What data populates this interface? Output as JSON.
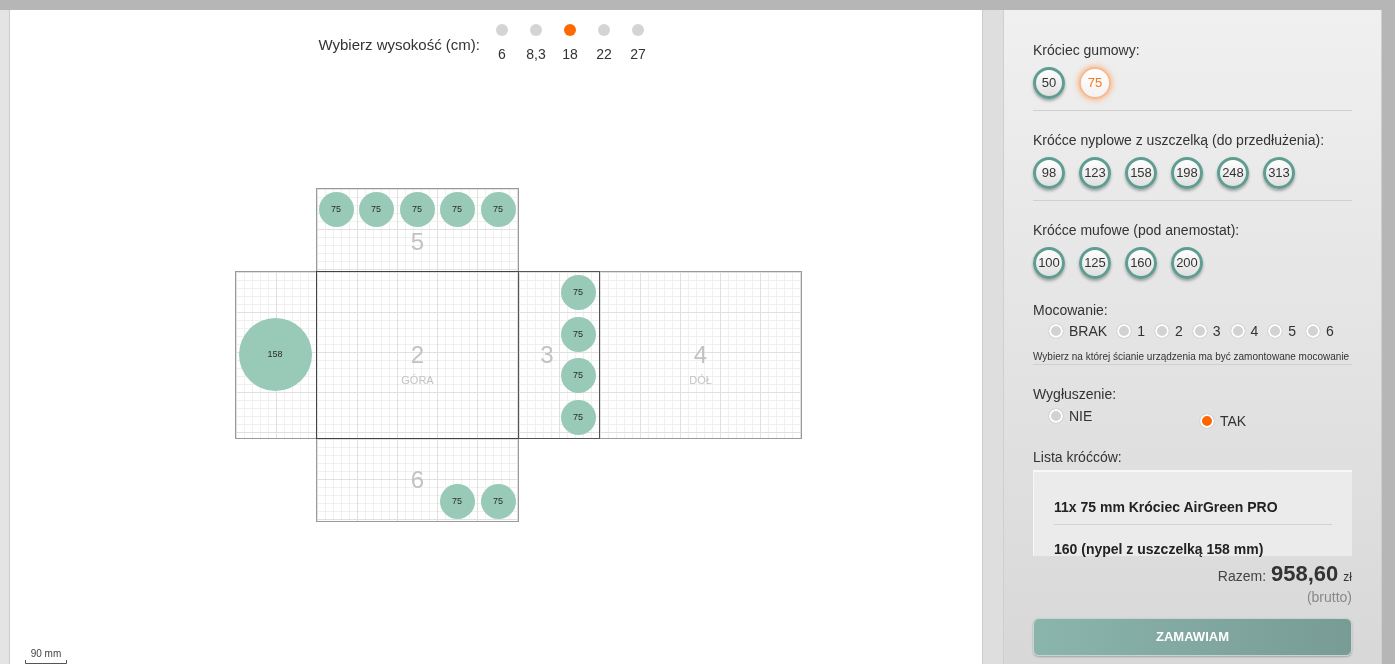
{
  "height_selector": {
    "label": "Wybierz wysokość (cm):",
    "options": [
      {
        "label": "6",
        "selected": false
      },
      {
        "label": "8,3",
        "selected": false
      },
      {
        "label": "18",
        "selected": true
      },
      {
        "label": "22",
        "selected": false
      },
      {
        "label": "27",
        "selected": false
      }
    ]
  },
  "net": {
    "faces": [
      {
        "number": "5",
        "fittings": [
          "75",
          "75",
          "75",
          "75",
          "75"
        ]
      },
      {
        "fittings": [
          "158"
        ]
      },
      {
        "number": "2",
        "name": "GÓRA"
      },
      {
        "number": "3",
        "fittings": [
          "75",
          "75",
          "75",
          "75"
        ]
      },
      {
        "number": "4",
        "name": "DÓŁ"
      },
      {
        "number": "6",
        "fittings": [
          "75",
          "75"
        ]
      }
    ]
  },
  "scale": {
    "label": "90 mm"
  },
  "panel": {
    "rubber_fitting": {
      "label": "Króciec gumowy:",
      "options": [
        {
          "label": "50",
          "selected": false
        },
        {
          "label": "75",
          "selected": true
        }
      ]
    },
    "nipple_fittings": {
      "label": "Króćce nyplowe z uszczelką (do przedłużenia):",
      "options": [
        {
          "label": "98",
          "selected": false
        },
        {
          "label": "123",
          "selected": false
        },
        {
          "label": "158",
          "selected": false
        },
        {
          "label": "198",
          "selected": false
        },
        {
          "label": "248",
          "selected": false
        },
        {
          "label": "313",
          "selected": false
        }
      ]
    },
    "socket_fittings": {
      "label": "Króćce mufowe (pod anemostat):",
      "options": [
        {
          "label": "100",
          "selected": false
        },
        {
          "label": "125",
          "selected": false
        },
        {
          "label": "160",
          "selected": false
        },
        {
          "label": "200",
          "selected": false
        }
      ]
    },
    "mounting": {
      "label": "Mocowanie:",
      "options": [
        {
          "label": "BRAK",
          "selected": false
        },
        {
          "label": "1",
          "selected": false
        },
        {
          "label": "2",
          "selected": false
        },
        {
          "label": "3",
          "selected": false
        },
        {
          "label": "4",
          "selected": false
        },
        {
          "label": "5",
          "selected": false
        },
        {
          "label": "6",
          "selected": false
        }
      ],
      "hint": "Wybierz na której ścianie urządzenia ma być zamontowane mocowanie"
    },
    "soundproofing": {
      "label": "Wygłuszenie:",
      "options": [
        {
          "label": "NIE",
          "selected": false
        },
        {
          "label": "TAK",
          "selected": true
        }
      ]
    },
    "fitting_list": {
      "label": "Lista króćców:",
      "items": [
        "11x 75 mm Króciec AirGreen PRO",
        "160 (nypel z uszczelką 158 mm)"
      ]
    },
    "total": {
      "label": "Razem:",
      "amount": "958,60",
      "currency": "zł",
      "note": "(brutto)"
    },
    "order_button": {
      "label": "ZAMAWIAM"
    }
  }
}
